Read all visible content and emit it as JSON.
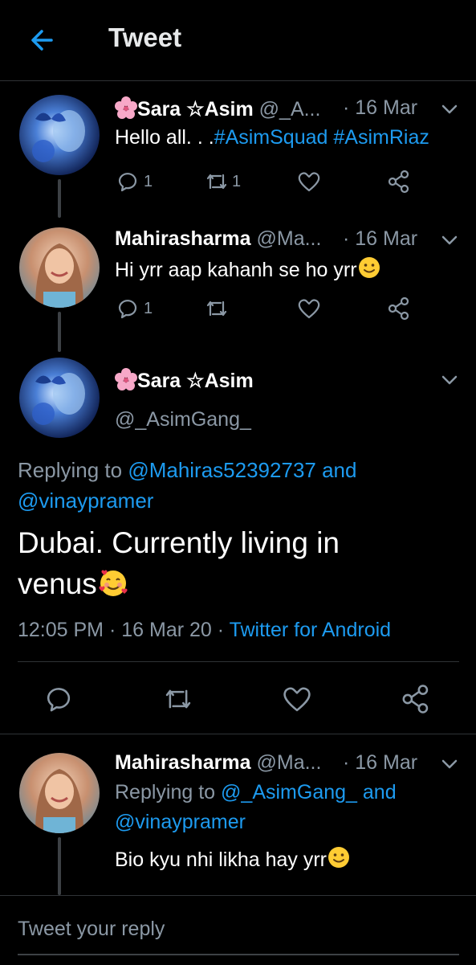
{
  "header": {
    "title": "Tweet"
  },
  "tweet1": {
    "name": "Sara ☆Asim",
    "handle": "@_A...",
    "date": "· 16 Mar",
    "text_plain": "Hello all. . .",
    "hashtag1": "#AsimSquad",
    "hashtag2": "#AsimRiaz",
    "reply_count": "1",
    "retweet_count": "1"
  },
  "tweet2": {
    "name": "Mahirasharma",
    "handle": "@Ma...",
    "date": "· 16 Mar",
    "text": "Hi yrr aap kahanh se ho yrr",
    "reply_count": "1"
  },
  "main_tweet": {
    "name": "Sara ☆Asim",
    "handle": "@_AsimGang_",
    "replying_prefix": "Replying to",
    "replying_user1": "@Mahiras52392737",
    "replying_and": "and",
    "replying_user2": "@vinaypramer",
    "text_line1": "Dubai.  Currently living in",
    "text_line2": "venus",
    "time": "12:05 PM",
    "date": "· 16 Mar 20 ·",
    "source": "Twitter for Android"
  },
  "tweet4": {
    "name": "Mahirasharma",
    "handle": "@Ma...",
    "date": "· 16 Mar",
    "replying_prefix": "Replying to",
    "replying_user1": "@_AsimGang_",
    "replying_and": "and",
    "replying_user2": "@vinaypramer",
    "text": "Bio kyu nhi likha hay yrr"
  },
  "reply_box": {
    "placeholder": "Tweet your reply"
  },
  "colors": {
    "accent": "#1d9bf0",
    "muted": "#8b98a5",
    "background": "#000000"
  },
  "icons": {
    "back": "arrow-left-icon",
    "more": "chevron-down-icon",
    "reply": "comment-icon",
    "retweet": "retweet-icon",
    "like": "heart-icon",
    "share": "share-icon",
    "flower": "cherry-blossom-emoji",
    "smile": "smile-emoji",
    "hearts": "smiling-face-with-hearts-emoji"
  }
}
